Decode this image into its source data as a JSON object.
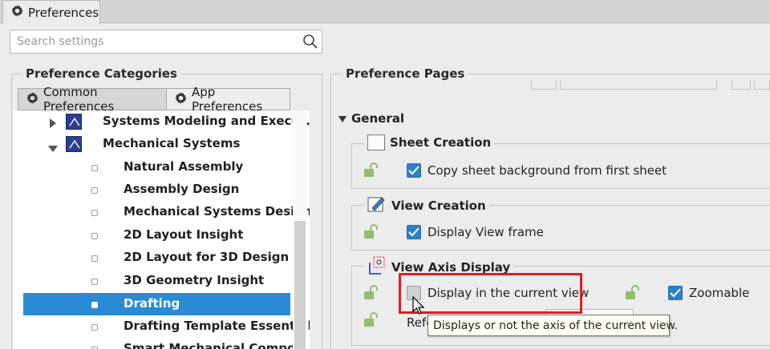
{
  "window": {
    "tab_title": "Preferences"
  },
  "search": {
    "placeholder": "Search settings"
  },
  "left": {
    "title": "Preference Categories",
    "tabs": [
      {
        "label": "Common Preferences",
        "active": true
      },
      {
        "label": "App Preferences",
        "active": false
      }
    ],
    "tree": [
      {
        "label": "Systems Modeling and Execut...",
        "level": 0,
        "expander": "collapsed"
      },
      {
        "label": "Mechanical Systems",
        "level": 0,
        "expander": "expanded"
      },
      {
        "label": "Natural Assembly",
        "level": 1
      },
      {
        "label": "Assembly Design",
        "level": 1
      },
      {
        "label": "Mechanical Systems Design",
        "level": 1
      },
      {
        "label": "2D Layout Insight",
        "level": 1
      },
      {
        "label": "2D Layout for 3D Design",
        "level": 1
      },
      {
        "label": "3D Geometry Insight",
        "level": 1
      },
      {
        "label": "Drafting",
        "level": 1,
        "selected": true
      },
      {
        "label": "Drafting Template Essentials",
        "level": 1
      },
      {
        "label": "Smart Mechanical Compo...",
        "level": 1
      }
    ]
  },
  "right": {
    "title": "Preference Pages",
    "section": "General",
    "groups": {
      "sheet_creation": {
        "title": "Sheet Creation",
        "option": "Copy sheet background from first sheet",
        "checked": true
      },
      "view_creation": {
        "title": "View Creation",
        "option": "Display View frame",
        "checked": true
      },
      "view_axis": {
        "title": "View Axis Display",
        "option": "Display in the current view",
        "checked": false,
        "zoomable": "Zoomable",
        "zoomable_checked": true,
        "partial_label": "Refe"
      }
    },
    "tooltip": "Displays or not the axis of the current view."
  },
  "colors": {
    "selection": "#2a8ad4",
    "checkbox_on": "#2c82c9",
    "highlight_box": "#e01b24",
    "tooltip_bg": "#ffffee"
  }
}
